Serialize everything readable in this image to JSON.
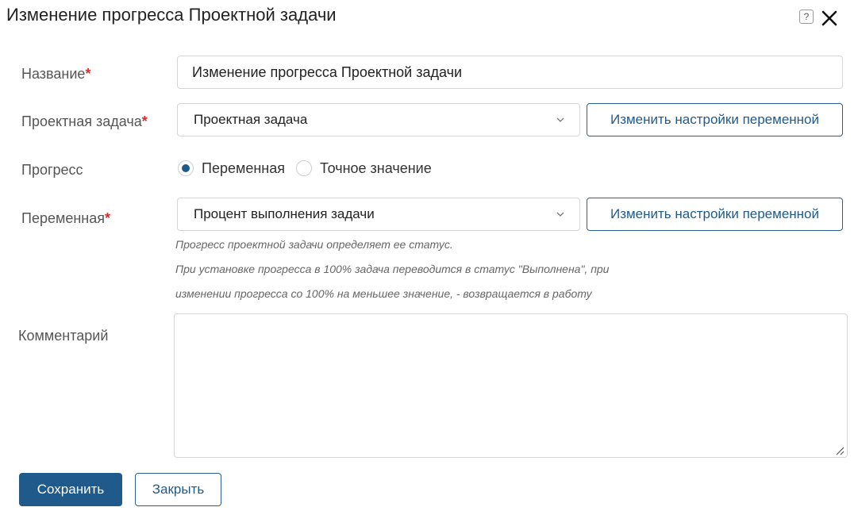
{
  "dialog": {
    "title": "Изменение прогресса Проектной задачи",
    "help_icon": "question-icon",
    "close_icon": "close-icon"
  },
  "form": {
    "name": {
      "label": "Название",
      "required_mark": "*",
      "value": "Изменение прогресса Проектной задачи"
    },
    "project_task": {
      "label": "Проектная задача",
      "required_mark": "*",
      "selected": "Проектная задача",
      "settings_button": "Изменить настройки переменной"
    },
    "progress": {
      "label": "Прогресс",
      "options": [
        {
          "label": "Переменная",
          "checked": true
        },
        {
          "label": "Точное значение",
          "checked": false
        }
      ]
    },
    "variable": {
      "label": "Переменная",
      "required_mark": "*",
      "selected": "Процент выполнения задачи",
      "settings_button": "Изменить настройки переменной",
      "hints": [
        "Прогресс проектной задачи определяет ее статус.",
        "При установке прогресса в 100% задача переводится в статус \"Выполнена\", при",
        "изменении прогресса со 100% на меньшее значение, - возвращается в работу"
      ]
    },
    "comment": {
      "label": "Комментарий",
      "value": ""
    }
  },
  "footer": {
    "save_label": "Сохранить",
    "close_label": "Закрыть"
  },
  "colors": {
    "accent": "#1f5a8a",
    "required": "#d32f2f",
    "border": "#d6d6d6"
  }
}
